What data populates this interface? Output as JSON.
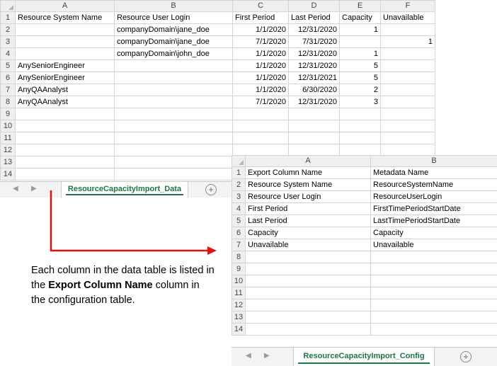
{
  "data_sheet": {
    "columns": [
      "A",
      "B",
      "C",
      "D",
      "E",
      "F"
    ],
    "rows": [
      {
        "num": "1",
        "cells": [
          "Resource System Name",
          "Resource User Login",
          "First Period",
          "Last Period",
          "Capacity",
          "Unavailable"
        ]
      },
      {
        "num": "2",
        "cells": [
          "",
          "companyDomain\\jane_doe",
          "1/1/2020",
          "12/31/2020",
          "1",
          ""
        ]
      },
      {
        "num": "3",
        "cells": [
          "",
          "companyDomain\\jane_doe",
          "7/1/2020",
          "7/31/2020",
          "",
          "1"
        ]
      },
      {
        "num": "4",
        "cells": [
          "",
          "companyDomain\\john_doe",
          "1/1/2020",
          "12/31/2020",
          "1",
          ""
        ]
      },
      {
        "num": "5",
        "cells": [
          "AnySeniorEngineer",
          "",
          "1/1/2020",
          "12/31/2020",
          "5",
          ""
        ]
      },
      {
        "num": "6",
        "cells": [
          "AnySeniorEngineer",
          "",
          "1/1/2020",
          "12/31/2021",
          "5",
          ""
        ]
      },
      {
        "num": "7",
        "cells": [
          "AnyQAAnalyst",
          "",
          "1/1/2020",
          "6/30/2020",
          "2",
          ""
        ]
      },
      {
        "num": "8",
        "cells": [
          "AnyQAAnalyst",
          "",
          "7/1/2020",
          "12/31/2020",
          "3",
          ""
        ]
      },
      {
        "num": "9",
        "cells": [
          "",
          "",
          "",
          "",
          "",
          ""
        ]
      },
      {
        "num": "10",
        "cells": [
          "",
          "",
          "",
          "",
          "",
          ""
        ]
      },
      {
        "num": "11",
        "cells": [
          "",
          "",
          "",
          "",
          "",
          ""
        ]
      },
      {
        "num": "12",
        "cells": [
          "",
          "",
          "",
          "",
          "",
          ""
        ]
      },
      {
        "num": "13",
        "cells": [
          "",
          "",
          "",
          "",
          "",
          ""
        ]
      },
      {
        "num": "14",
        "cells": [
          "",
          "",
          "",
          "",
          "",
          ""
        ]
      }
    ],
    "tab_label": "ResourceCapacityImport_Data"
  },
  "config_sheet": {
    "columns": [
      "A",
      "B"
    ],
    "rows": [
      {
        "num": "1",
        "cells": [
          "Export Column Name",
          "Metadata Name"
        ]
      },
      {
        "num": "2",
        "cells": [
          "Resource System Name",
          "ResourceSystemName"
        ]
      },
      {
        "num": "3",
        "cells": [
          "Resource User Login",
          "ResourceUserLogin"
        ]
      },
      {
        "num": "4",
        "cells": [
          "First Period",
          "FirstTimePeriodStartDate"
        ]
      },
      {
        "num": "5",
        "cells": [
          "Last Period",
          "LastTimePeriodStartDate"
        ]
      },
      {
        "num": "6",
        "cells": [
          "Capacity",
          "Capacity"
        ]
      },
      {
        "num": "7",
        "cells": [
          "Unavailable",
          "Unavailable"
        ]
      },
      {
        "num": "8",
        "cells": [
          "",
          ""
        ]
      },
      {
        "num": "9",
        "cells": [
          "",
          ""
        ]
      },
      {
        "num": "10",
        "cells": [
          "",
          ""
        ]
      },
      {
        "num": "11",
        "cells": [
          "",
          ""
        ]
      },
      {
        "num": "12",
        "cells": [
          "",
          ""
        ]
      },
      {
        "num": "13",
        "cells": [
          "",
          ""
        ]
      },
      {
        "num": "14",
        "cells": [
          "",
          ""
        ]
      }
    ],
    "tab_label": "ResourceCapacityImport_Config"
  },
  "annotation": {
    "line1": "Each column in the data table is listed in the ",
    "bold": "Export Column Name",
    "line2": " column in the configuration table."
  },
  "icons": {
    "nav_prev": "◀",
    "nav_next": "▶",
    "add_sheet": "+"
  },
  "colors": {
    "arrow": "#e8100b",
    "tab_accent": "#217346"
  }
}
